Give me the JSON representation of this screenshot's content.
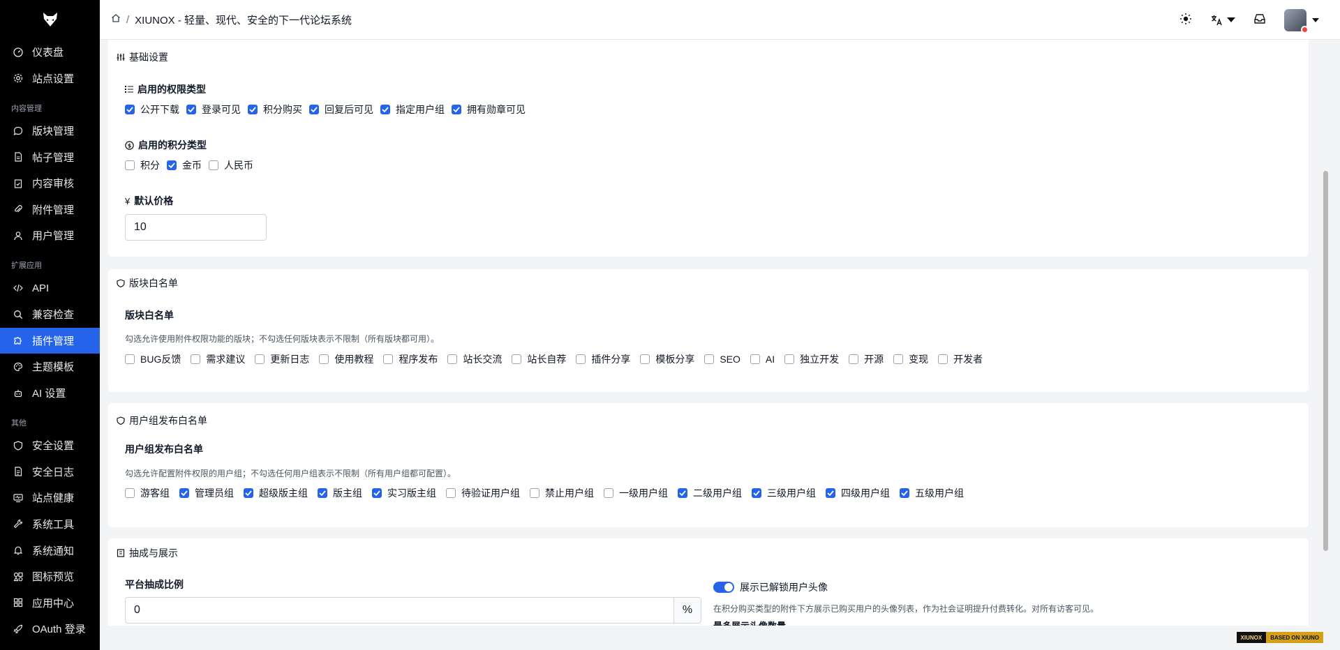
{
  "header": {
    "breadcrumb_title": "XIUNOX - 轻量、现代、安全的下一代论坛系统"
  },
  "sidebar": {
    "items": [
      {
        "type": "item",
        "label": "仪表盘",
        "icon": "gauge-icon"
      },
      {
        "type": "item",
        "label": "站点设置",
        "icon": "gear-icon"
      },
      {
        "type": "section",
        "label": "内容管理"
      },
      {
        "type": "item",
        "label": "版块管理",
        "icon": "chat-bubble-icon"
      },
      {
        "type": "item",
        "label": "帖子管理",
        "icon": "document-icon"
      },
      {
        "type": "item",
        "label": "内容审核",
        "icon": "clipboard-check-icon"
      },
      {
        "type": "item",
        "label": "附件管理",
        "icon": "paperclip-icon"
      },
      {
        "type": "item",
        "label": "用户管理",
        "icon": "user-icon"
      },
      {
        "type": "section",
        "label": "扩展应用"
      },
      {
        "type": "item",
        "label": "API",
        "icon": "code-icon"
      },
      {
        "type": "item",
        "label": "兼容检查",
        "icon": "magnifier-icon"
      },
      {
        "type": "item",
        "label": "插件管理",
        "icon": "puzzle-icon",
        "active": true
      },
      {
        "type": "item",
        "label": "主题模板",
        "icon": "palette-icon"
      },
      {
        "type": "item",
        "label": "AI 设置",
        "icon": "robot-icon"
      },
      {
        "type": "section",
        "label": "其他"
      },
      {
        "type": "item",
        "label": "安全设置",
        "icon": "shield-icon"
      },
      {
        "type": "item",
        "label": "安全日志",
        "icon": "log-document-icon"
      },
      {
        "type": "item",
        "label": "站点健康",
        "icon": "monitor-heart-icon"
      },
      {
        "type": "item",
        "label": "系统工具",
        "icon": "wrench-icon"
      },
      {
        "type": "item",
        "label": "系统通知",
        "icon": "bell-icon"
      },
      {
        "type": "item",
        "label": "图标预览",
        "icon": "shapes-icon"
      },
      {
        "type": "item",
        "label": "应用中心",
        "icon": "grid-icon"
      },
      {
        "type": "item",
        "label": "OAuth 登录",
        "icon": "rocket-icon"
      }
    ]
  },
  "basic": {
    "title": "基础设置",
    "perm_title": "启用的权限类型",
    "perm_options": [
      {
        "label": "公开下载",
        "checked": true
      },
      {
        "label": "登录可见",
        "checked": true
      },
      {
        "label": "积分购买",
        "checked": true
      },
      {
        "label": "回复后可见",
        "checked": true
      },
      {
        "label": "指定用户组",
        "checked": true
      },
      {
        "label": "拥有勋章可见",
        "checked": true
      }
    ],
    "credit_title": "启用的积分类型",
    "credit_options": [
      {
        "label": "积分",
        "checked": false
      },
      {
        "label": "金币",
        "checked": true
      },
      {
        "label": "人民币",
        "checked": false
      }
    ],
    "price_title": "默认价格",
    "price_value": "10"
  },
  "forum_whitelist": {
    "title": "版块白名单",
    "subtitle": "版块白名单",
    "hint": "勾选允许使用附件权限功能的版块；不勾选任何版块表示不限制（所有版块都可用）。",
    "options": [
      {
        "label": "BUG反馈",
        "checked": false
      },
      {
        "label": "需求建议",
        "checked": false
      },
      {
        "label": "更新日志",
        "checked": false
      },
      {
        "label": "使用教程",
        "checked": false
      },
      {
        "label": "程序发布",
        "checked": false
      },
      {
        "label": "站长交流",
        "checked": false
      },
      {
        "label": "站长自荐",
        "checked": false
      },
      {
        "label": "插件分享",
        "checked": false
      },
      {
        "label": "模板分享",
        "checked": false
      },
      {
        "label": "SEO",
        "checked": false
      },
      {
        "label": "AI",
        "checked": false
      },
      {
        "label": "独立开发",
        "checked": false
      },
      {
        "label": "开源",
        "checked": false
      },
      {
        "label": "变现",
        "checked": false
      },
      {
        "label": "开发者",
        "checked": false
      }
    ]
  },
  "group_whitelist": {
    "title": "用户组发布白名单",
    "subtitle": "用户组发布白名单",
    "hint": "勾选允许配置附件权限的用户组；不勾选任何用户组表示不限制（所有用户组都可配置）。",
    "options": [
      {
        "label": "游客组",
        "checked": false
      },
      {
        "label": "管理员组",
        "checked": true
      },
      {
        "label": "超级版主组",
        "checked": true
      },
      {
        "label": "版主组",
        "checked": true
      },
      {
        "label": "实习版主组",
        "checked": true
      },
      {
        "label": "待验证用户组",
        "checked": false
      },
      {
        "label": "禁止用户组",
        "checked": false
      },
      {
        "label": "一级用户组",
        "checked": false
      },
      {
        "label": "二级用户组",
        "checked": true
      },
      {
        "label": "三级用户组",
        "checked": true
      },
      {
        "label": "四级用户组",
        "checked": true
      },
      {
        "label": "五级用户组",
        "checked": true
      }
    ]
  },
  "commission": {
    "title": "抽成与展示",
    "rate_label": "平台抽成比例",
    "rate_value": "0",
    "rate_suffix": "%",
    "toggle_label": "展示已解锁用户头像",
    "toggle_on": true,
    "toggle_hint": "在积分购买类型的附件下方展示已购买用户的头像列表，作为社会证明提升付费转化。对所有访客可见。",
    "partial_label": "最多展示头像数量"
  },
  "badge": {
    "left": "XIUNOX",
    "right": "BASED ON XIUNO"
  },
  "colors": {
    "accent": "#2563eb",
    "sidebar_bg": "#000000",
    "page_bg": "#f3f4f6"
  }
}
